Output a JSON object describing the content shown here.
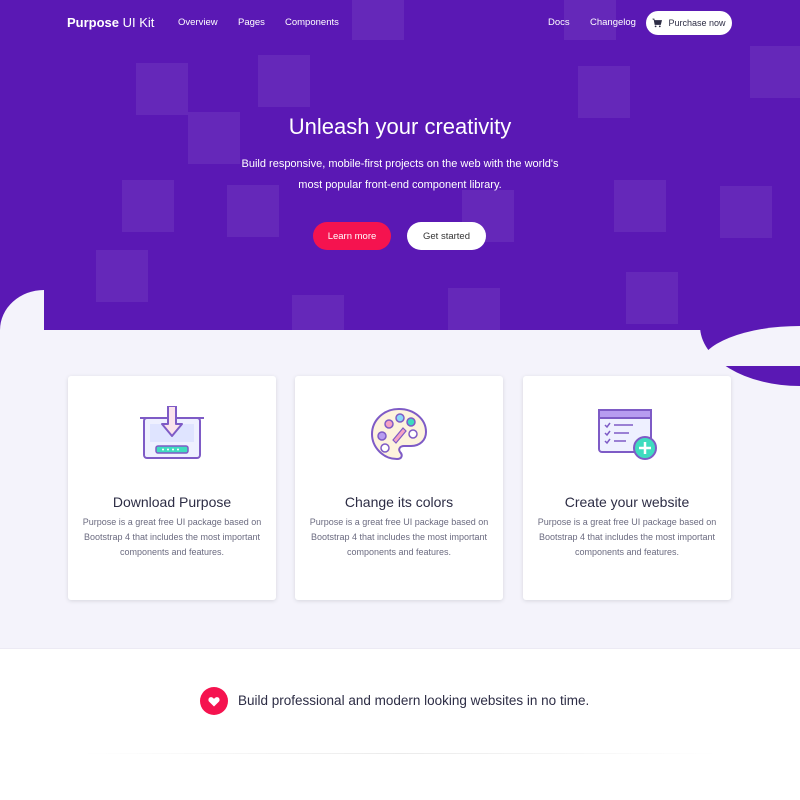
{
  "nav": {
    "brand_bold": "Purpose",
    "brand_light": "UI Kit",
    "links_left": [
      "Overview",
      "Pages",
      "Components"
    ],
    "links_right": [
      "Docs",
      "Changelog"
    ],
    "purchase_label": "Purchase now",
    "purchase_icon": "cart-icon"
  },
  "hero": {
    "title": "Unleash your creativity",
    "subtitle": "Build responsive, mobile-first projects on the web with the world's most popular front-end component library.",
    "learn_more_label": "Learn more",
    "get_started_label": "Get started"
  },
  "features": [
    {
      "icon": "download-icon",
      "title": "Download Purpose",
      "text": "Purpose is a great free UI package based on Bootstrap 4 that includes the most important components and features."
    },
    {
      "icon": "palette-icon",
      "title": "Change its colors",
      "text": "Purpose is a great free UI package based on Bootstrap 4 that includes the most important components and features."
    },
    {
      "icon": "website-checklist-icon",
      "title": "Create your website",
      "text": "Purpose is a great free UI package based on Bootstrap 4 that includes the most important components and features."
    }
  ],
  "callout": {
    "icon": "heart-icon",
    "text": "Build professional and modern looking websites in no time."
  },
  "colors": {
    "hero_bg": "#5a18b4",
    "accent": "#f5134f",
    "page_bg": "#f4f3fb",
    "icon_outline": "#7e5bc6",
    "icon_teal": "#3fdcbf"
  }
}
